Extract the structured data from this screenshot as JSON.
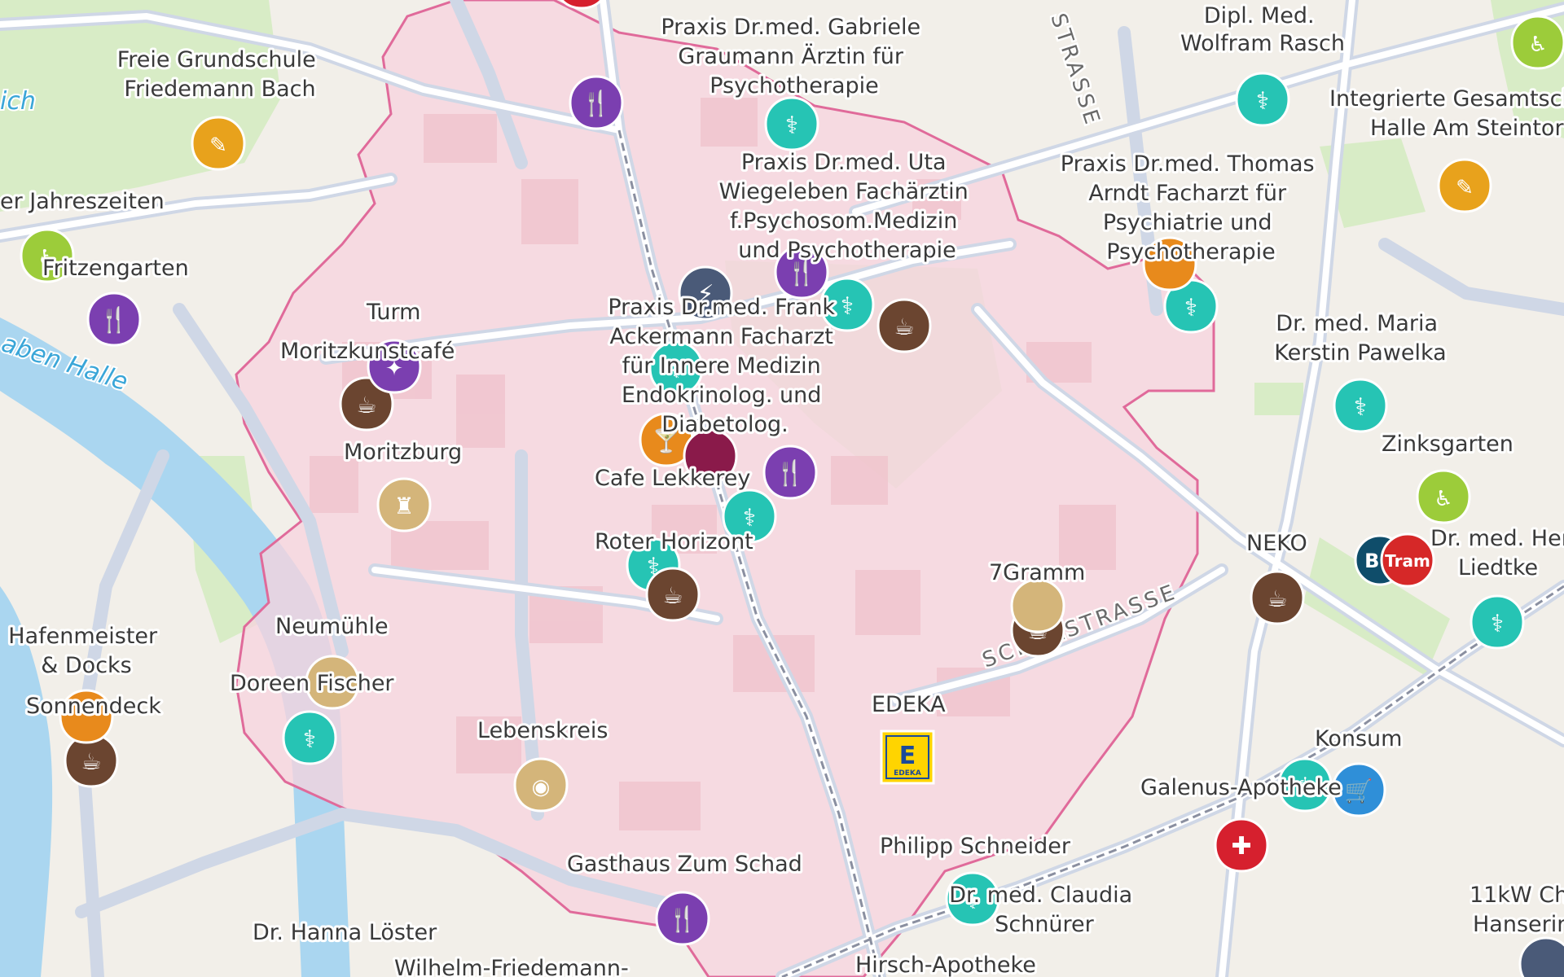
{
  "colors": {
    "restaurant": "#7b3fb0",
    "doctor": "#26c4b4",
    "cafe": "#6b4530",
    "school": "#e8a21c",
    "park": "#9ccc3a",
    "culture": "#d4b57a",
    "pharmacy": "#d6202e",
    "bar": "#e88a1c",
    "energy": "#4a5a78",
    "shop": "#2f8fd8",
    "tram": "#d62828",
    "bus": "#0f4d6a",
    "edeka": "#ffd400",
    "zone": "#e06a9a"
  },
  "labels": {
    "freie_grundschule": [
      "Freie Grundschule",
      "Friedemann Bach"
    ],
    "praxis_graumann": [
      "Praxis Dr.med. Gabriele",
      "Graumann Ärztin für",
      "Psychotherapie"
    ],
    "rasch": [
      "Dipl. Med.",
      "Wolfram Rasch"
    ],
    "gesamtschule": [
      "Integrierte Gesamtsch",
      "Halle Am Steintor"
    ],
    "jahreszeiten": "er Jahreszeiten",
    "fritzengarten": "Fritzengarten",
    "praxis_wiegeleben": [
      "Praxis Dr.med. Uta",
      "Wiegeleben Fachärztin",
      "f.Psychosom.Medizin",
      "und Psychotherapie"
    ],
    "praxis_arndt": [
      "Praxis Dr.med. Thomas",
      "Arndt Facharzt für",
      "Psychiatrie und",
      "Psychotherapie"
    ],
    "turm": "Turm",
    "moritzkunstcafe": "Moritzkunstcafé",
    "praxis_ackermann": [
      "Praxis Dr.med. Frank",
      "Ackermann Facharzt",
      "für Innere Medizin",
      "Endokrinolog. und",
      "Diabetolog."
    ],
    "pawelka": [
      "Dr. med. Maria",
      "Kerstin Pawelka"
    ],
    "moritzburg": "Moritzburg",
    "cafe_lekkerey": "Cafe Lekkerey",
    "zinksgarten": "Zinksgarten",
    "roter_horizont": "Roter Horizont",
    "neko": "NEKO",
    "liedtke": [
      "Dr. med. Hend",
      "Liedtke"
    ],
    "siebengramm": "7Gramm",
    "neumuehle": "Neumühle",
    "hafenmeister": [
      "Hafenmeister",
      "& Docks"
    ],
    "doreen_fischer": "Doreen Fischer",
    "sonnendeck": "Sonnendeck",
    "edeka": "EDEKA",
    "lebenskreis": "Lebenskreis",
    "konsum": "Konsum",
    "galenus": "Galenus-Apotheke",
    "philipp_schneider": "Philipp Schneider",
    "gasthaus": "Gasthaus Zum Schad",
    "schnuerer": [
      "Dr. med. Claudia",
      "Schnürer"
    ],
    "charger": [
      "11kW Ch",
      "Hanserin"
    ],
    "loester": "Dr. Hanna Löster",
    "wilhelm": "Wilhelm-Friedemann-",
    "hirsch": "Hirsch-Apotheke"
  },
  "streets": {
    "schulstrasse": "SCHULSTRASSE",
    "strasse_top": "STRASSE"
  },
  "water": {
    "graben": "aben Halle",
    "ich": "ich"
  },
  "badges": {
    "tram": "Tram",
    "bus": "BU",
    "edeka_logo": "E",
    "edeka_small": "EDEKA"
  }
}
